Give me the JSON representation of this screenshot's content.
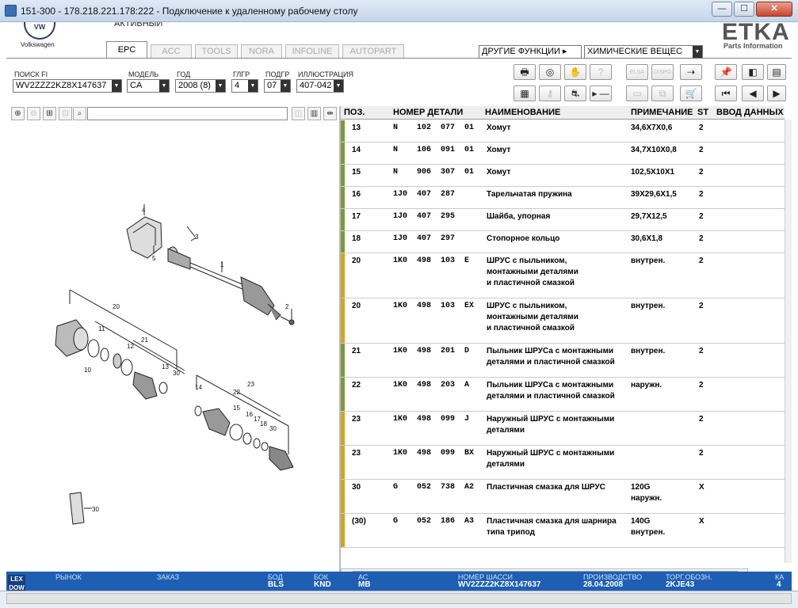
{
  "window": {
    "title": "151-300 - 178.218.221.178:222 - Подключение к удаленному рабочему столу",
    "btn_min": "—",
    "btn_max": "☐",
    "btn_close": "✕"
  },
  "header": {
    "vw_logo": "VW",
    "brand": "Volkswagen",
    "status_text": "АКТИВНЫЙ",
    "etka_logo": "ETKA",
    "etka_sub": "Parts Information"
  },
  "tabs": [
    {
      "label": "EPC",
      "active": true
    },
    {
      "label": "ACC"
    },
    {
      "label": "TOOLS"
    },
    {
      "label": "NORA"
    },
    {
      "label": "INFOLINE"
    },
    {
      "label": "AUTOPART"
    }
  ],
  "functions": {
    "other_label": "ДРУГИЕ ФУНКЦИИ ▸",
    "chem_select": "ХИМИЧЕСКИЕ ВЕЩЕС"
  },
  "filters": {
    "search_fi": {
      "label": "ПОИСК FI",
      "value": "WV2ZZZ2KZ8X147637"
    },
    "model": {
      "label": "МОДЕЛЬ",
      "value": "CA"
    },
    "year": {
      "label": "ГОД",
      "value": "2008 (8)"
    },
    "main_group": {
      "label": "ГЛГР",
      "value": "4"
    },
    "sub_group": {
      "label": "ПОДГР",
      "value": "07"
    },
    "illustration": {
      "label": "ИЛЛЮСТРАЦИЯ",
      "value": "407-042"
    }
  },
  "toolbar": {
    "print_icon": "print-icon",
    "elsa_label": "ELSA",
    "dispo_label": "DISPO",
    "pin_icon": "pin-icon",
    "arrow_label": "▸ —"
  },
  "table": {
    "headers": {
      "pos": "ПОЗ.",
      "part": "НОМЕР ДЕТАЛИ",
      "name": "НАИМЕНОВАНИЕ",
      "note": "ПРИМЕЧАНИЕ",
      "st": "ST",
      "entry": "ВВОД ДАННЫХ П"
    },
    "rows": [
      {
        "pos": "13",
        "pfx": "N",
        "g1": "102",
        "g2": "077",
        "g3": "01",
        "name": "Хомут",
        "note": "34,6X7X0,6",
        "st": "2",
        "mark": "#7a9a3b"
      },
      {
        "pos": "14",
        "pfx": "N",
        "g1": "106",
        "g2": "091",
        "g3": "01",
        "name": "Хомут",
        "note": "34,7X10X0,8",
        "st": "2",
        "mark": "#7a9a3b"
      },
      {
        "pos": "15",
        "pfx": "N",
        "g1": "906",
        "g2": "307",
        "g3": "01",
        "name": "Хомут",
        "note": "102,5X10X1",
        "st": "2",
        "mark": "#7a9a3b"
      },
      {
        "pos": "16",
        "pfx": "1J0",
        "g1": "407",
        "g2": "287",
        "g3": "",
        "name": "Тарельчатая пружина",
        "note": "39X29,6X1,5",
        "st": "2",
        "mark": "#7a9a3b"
      },
      {
        "pos": "17",
        "pfx": "1J0",
        "g1": "407",
        "g2": "295",
        "g3": "",
        "name": "Шайба, упорная",
        "note": "29,7X12,5",
        "st": "2",
        "mark": "#7a9a3b"
      },
      {
        "pos": "18",
        "pfx": "1J0",
        "g1": "407",
        "g2": "297",
        "g3": "",
        "name": "Стопорное кольцо",
        "note": "30,6X1,8",
        "st": "2",
        "mark": "#7a9a3b"
      },
      {
        "pos": "20",
        "pfx": "1K0",
        "g1": "498",
        "g2": "103",
        "g3": "E",
        "name": "ШРУС с пыльником,",
        "name2": "монтажными деталями",
        "name3": "и пластичной смазкой",
        "note": "внутрен.",
        "st": "2",
        "mark": "#d9a21b"
      },
      {
        "pos": "20",
        "pfx": "1K0",
        "g1": "498",
        "g2": "103",
        "g3": "EX",
        "name": "ШРУС с пыльником,",
        "name2": "монтажными деталями",
        "name3": "и пластичной смазкой",
        "note": "внутрен.",
        "st": "2",
        "mark": "#d9a21b"
      },
      {
        "pos": "21",
        "pfx": "1K0",
        "g1": "498",
        "g2": "201",
        "g3": "D",
        "name": "Пыльник ШРУСа с монтажными",
        "name2": "деталями и пластичной смазкой",
        "note": "внутрен.",
        "st": "2",
        "mark": "#7a9a3b"
      },
      {
        "pos": "22",
        "pfx": "1K0",
        "g1": "498",
        "g2": "203",
        "g3": "A",
        "name": "Пыльник ШРУСа с монтажными",
        "name2": "деталями и пластичной смазкой",
        "note": "наружн.",
        "st": "2",
        "mark": "#7a9a3b"
      },
      {
        "pos": "23",
        "pfx": "1K0",
        "g1": "498",
        "g2": "099",
        "g3": "J",
        "name": "Наружный ШРУС с монтажными",
        "name2": "деталями",
        "note": "",
        "st": "2",
        "mark": "#d9a21b"
      },
      {
        "pos": "23",
        "pfx": "1K0",
        "g1": "498",
        "g2": "099",
        "g3": "BX",
        "name": "Наружный ШРУС с монтажными",
        "name2": "деталями",
        "note": "",
        "st": "2",
        "mark": "#d9a21b"
      },
      {
        "pos": "30",
        "pfx": "G",
        "g1": "052",
        "g2": "738",
        "g3": "A2",
        "name": "Пластичная смазка для ШРУС",
        "note": "120G",
        "note2": "наружн.",
        "st": "X",
        "mark": "#d9a21b"
      },
      {
        "pos": "(30)",
        "pfx": "G",
        "g1": "052",
        "g2": "186",
        "g3": "A3",
        "name": "Пластичная смазка для шарнира",
        "name2": "типа трипод",
        "note": "140G",
        "note2": "внутрен.",
        "st": "X",
        "mark": "#d9a21b"
      }
    ]
  },
  "diagram_labels": [
    "4",
    "3",
    "5",
    "1",
    "2",
    "20",
    "11",
    "12",
    "21",
    "10",
    "13",
    "30",
    "14",
    "22",
    "23",
    "15",
    "16",
    "17",
    "18",
    "30",
    "30"
  ],
  "status": {
    "lex": "LEX DOW",
    "market": "РЫНОК",
    "order": "ЗАКАЗ",
    "bod_label": "БОД",
    "bod_value": "BLS",
    "bok_label": "БОК",
    "bok_value": "KND",
    "ac_label": "АС",
    "ac_value": "MB",
    "chassis_label": "НОМЕР ШАССИ",
    "chassis_value": "WV2ZZZ2KZ8X147637",
    "prod_label": "ПРОИЗВОДСТВО",
    "prod_value": "28.04.2008",
    "trade_label": "ТОРГ.ОБОЗН.",
    "trade_value": "2KJE43",
    "ka_label": "КА",
    "ka_value": "4"
  },
  "colors": {
    "accent": "#1e5fb4",
    "green_mark": "#7a9a3b",
    "yellow_mark": "#d9a21b"
  }
}
